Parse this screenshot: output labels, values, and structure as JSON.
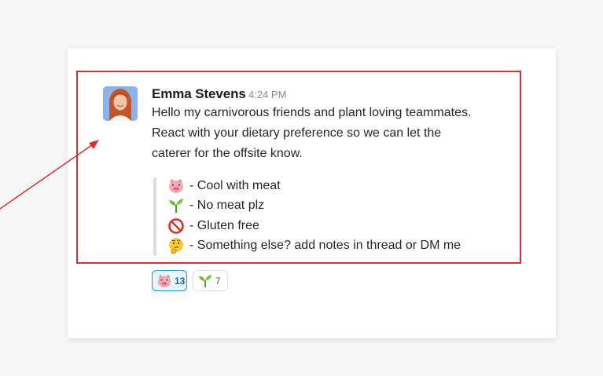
{
  "message": {
    "sender": "Emma Stevens",
    "timestamp": "4:24 PM",
    "lines": [
      "Hello my carnivorous friends and plant loving teammates.",
      "React with your dietary preference so we can let the",
      "caterer for the offsite know."
    ]
  },
  "options": [
    {
      "icon": "pig-face-icon",
      "text": "- Cool with meat"
    },
    {
      "icon": "seedling-icon",
      "text": "- No meat plz"
    },
    {
      "icon": "no-entry-sign-icon",
      "text": "- Gluten free"
    },
    {
      "icon": "thinking-face-icon",
      "text": "- Something else? add notes in thread or DM me"
    }
  ],
  "reactions": [
    {
      "icon": "pig-face-icon",
      "count": "13",
      "selected": true
    },
    {
      "icon": "seedling-icon",
      "count": "7",
      "selected": false
    }
  ],
  "colors": {
    "highlight_box": "#d62f36",
    "arrow": "#d62f36",
    "selected_reaction_border": "#1d9bd1",
    "selected_reaction_bg": "#e8f5fa"
  }
}
